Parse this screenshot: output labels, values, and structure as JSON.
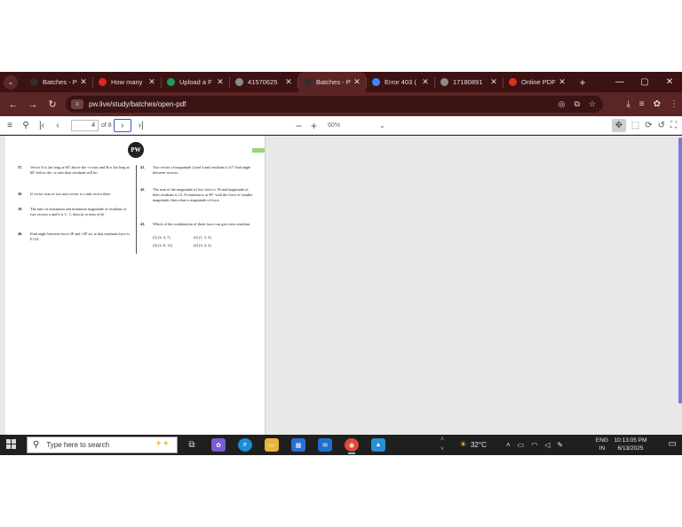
{
  "browser": {
    "tabs": [
      {
        "label": "Batches - P",
        "icon": "pw-favicon",
        "fav_color": "#2f2f2f",
        "active": false
      },
      {
        "label": "How many",
        "icon": "youtube-favicon",
        "fav_color": "#e02626",
        "active": false
      },
      {
        "label": "Upload a F",
        "icon": "docs-favicon",
        "fav_color": "#1f9d55",
        "active": false
      },
      {
        "label": "41570625",
        "icon": "globe-favicon",
        "fav_color": "#8a8a8a",
        "active": false
      },
      {
        "label": "Batches - P",
        "icon": "pw-favicon",
        "fav_color": "#2f2f2f",
        "active": true
      },
      {
        "label": "Error 403 (",
        "icon": "google-favicon",
        "fav_color": "#4285f4",
        "active": false
      },
      {
        "label": "17180891",
        "icon": "globe-favicon",
        "fav_color": "#8a8a8a",
        "active": false
      },
      {
        "label": "Online PDF",
        "icon": "pdf-favicon",
        "fav_color": "#d93025",
        "active": false
      }
    ],
    "close_glyph": "✕",
    "new_tab_glyph": "+",
    "url": "pw.live/study/batches/open-pdf",
    "nav": {
      "back": "←",
      "forward": "→",
      "reload": "↻"
    },
    "window": {
      "minimize": "—",
      "maximize": "▢",
      "close": "✕"
    }
  },
  "pdf_toolbar": {
    "current_page": "4",
    "of_label": "of 8",
    "zoom": "60%"
  },
  "document": {
    "logo_text": "PW",
    "questions_left": [
      {
        "num": "37.",
        "text": "Vector A is 2m long at 60° above the +x-axis and B is 3m long at 60° below the +x-axis then resultant will be :"
      },
      {
        "num": "38.",
        "text": "If vector sum of two unit vector is a unit vector then:"
      },
      {
        "num": "39.",
        "text": "The ratio of maximum and minimum magnitude of resultant of two vectors a and b is 3 : 1, then |a| in term of |b| :"
      },
      {
        "num": "40.",
        "text": "Find angle between force 2F and √2F act at that resultant force is F√10."
      }
    ],
    "questions_right": [
      {
        "num": "41.",
        "text": "Two vector of magnitude 2 and 4 and resultant is 2√7 find angle between vectors."
      },
      {
        "num": "42.",
        "text": "The sum of the magnitude of two force is 18 and magnitude of their resultant is 12. If resultant is at 90° with the force of smaller magnitude, then what is magnitude of force"
      },
      {
        "num": "43.",
        "text": "Which of the combination of three force can give zero resultant"
      }
    ],
    "options_43": [
      "(1) (2, 4, 7)",
      "(2) (1, 3, 5)",
      "(3) (2, 8, 11)",
      "(4) (3, 4, 2)"
    ]
  },
  "taskbar": {
    "search_placeholder": "Type here to search",
    "weather": "32°C",
    "lang_top": "ENG",
    "lang_bottom": "IN",
    "time": "10:13:05 PM",
    "date": "6/13/2025"
  }
}
